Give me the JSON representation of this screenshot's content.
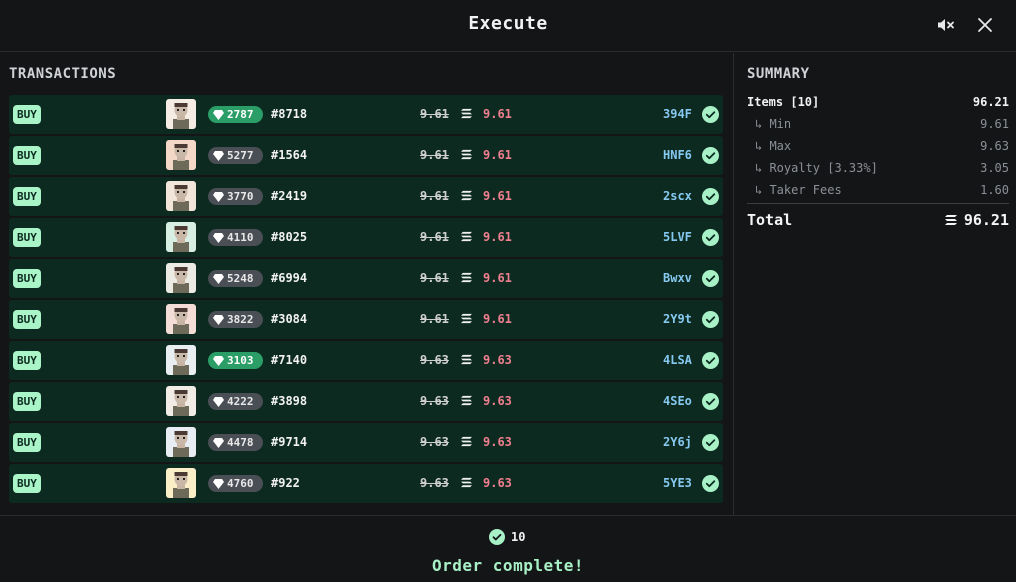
{
  "header": {
    "title": "Execute",
    "mute_icon": "speaker-muted-icon",
    "close_icon": "close-icon"
  },
  "transactions": {
    "title": "TRANSACTIONS",
    "rows": [
      {
        "type": "BUY",
        "avatar_bg": "#f5ece4",
        "rarity": "2787",
        "rarity_tier": "green",
        "token": "#8718",
        "old_price": "9.61",
        "price": "9.61",
        "sig": "394F",
        "status": "complete"
      },
      {
        "type": "BUY",
        "avatar_bg": "#f3d8c8",
        "rarity": "5277",
        "rarity_tier": "gray",
        "token": "#1564",
        "old_price": "9.61",
        "price": "9.61",
        "sig": "HNF6",
        "status": "complete"
      },
      {
        "type": "BUY",
        "avatar_bg": "#f2e6da",
        "rarity": "3770",
        "rarity_tier": "gray",
        "token": "#2419",
        "old_price": "9.61",
        "price": "9.61",
        "sig": "2scx",
        "status": "complete"
      },
      {
        "type": "BUY",
        "avatar_bg": "#d6efe2",
        "rarity": "4110",
        "rarity_tier": "gray",
        "token": "#8025",
        "old_price": "9.61",
        "price": "9.61",
        "sig": "5LVF",
        "status": "complete"
      },
      {
        "type": "BUY",
        "avatar_bg": "#ecebe3",
        "rarity": "5248",
        "rarity_tier": "gray",
        "token": "#6994",
        "old_price": "9.61",
        "price": "9.61",
        "sig": "Bwxv",
        "status": "complete"
      },
      {
        "type": "BUY",
        "avatar_bg": "#f4ddd6",
        "rarity": "3822",
        "rarity_tier": "gray",
        "token": "#3084",
        "old_price": "9.61",
        "price": "9.61",
        "sig": "2Y9t",
        "status": "complete"
      },
      {
        "type": "BUY",
        "avatar_bg": "#e9eef0",
        "rarity": "3103",
        "rarity_tier": "green",
        "token": "#7140",
        "old_price": "9.63",
        "price": "9.63",
        "sig": "4LSA",
        "status": "complete"
      },
      {
        "type": "BUY",
        "avatar_bg": "#f1ece6",
        "rarity": "4222",
        "rarity_tier": "gray",
        "token": "#3898",
        "old_price": "9.63",
        "price": "9.63",
        "sig": "4SEo",
        "status": "complete"
      },
      {
        "type": "BUY",
        "avatar_bg": "#e8ecf3",
        "rarity": "4478",
        "rarity_tier": "gray",
        "token": "#9714",
        "old_price": "9.63",
        "price": "9.63",
        "sig": "2Y6j",
        "status": "complete"
      },
      {
        "type": "BUY",
        "avatar_bg": "#fbefc8",
        "rarity": "4760",
        "rarity_tier": "gray",
        "token": "#922",
        "old_price": "9.63",
        "price": "9.63",
        "sig": "5YE3",
        "status": "complete"
      }
    ]
  },
  "summary": {
    "title": "SUMMARY",
    "items_label": "Items [10]",
    "items_value": "96.21",
    "lines": [
      {
        "label": "↳ Min",
        "value": "9.61"
      },
      {
        "label": "↳ Max",
        "value": "9.63"
      },
      {
        "label": "↳ Royalty [3.33%]",
        "value": "3.05"
      },
      {
        "label": "↳ Taker Fees",
        "value": "1.60"
      }
    ],
    "total_label": "Total",
    "total_value": "96.21",
    "currency_icon": "solana-icon"
  },
  "footer": {
    "completed_count": "10",
    "message": "Order complete!"
  },
  "colors": {
    "row_bg": "#0c2a20",
    "accent_green": "#a8f0c6",
    "price_red": "#f07f8f",
    "sig_blue": "#86c9f0"
  }
}
